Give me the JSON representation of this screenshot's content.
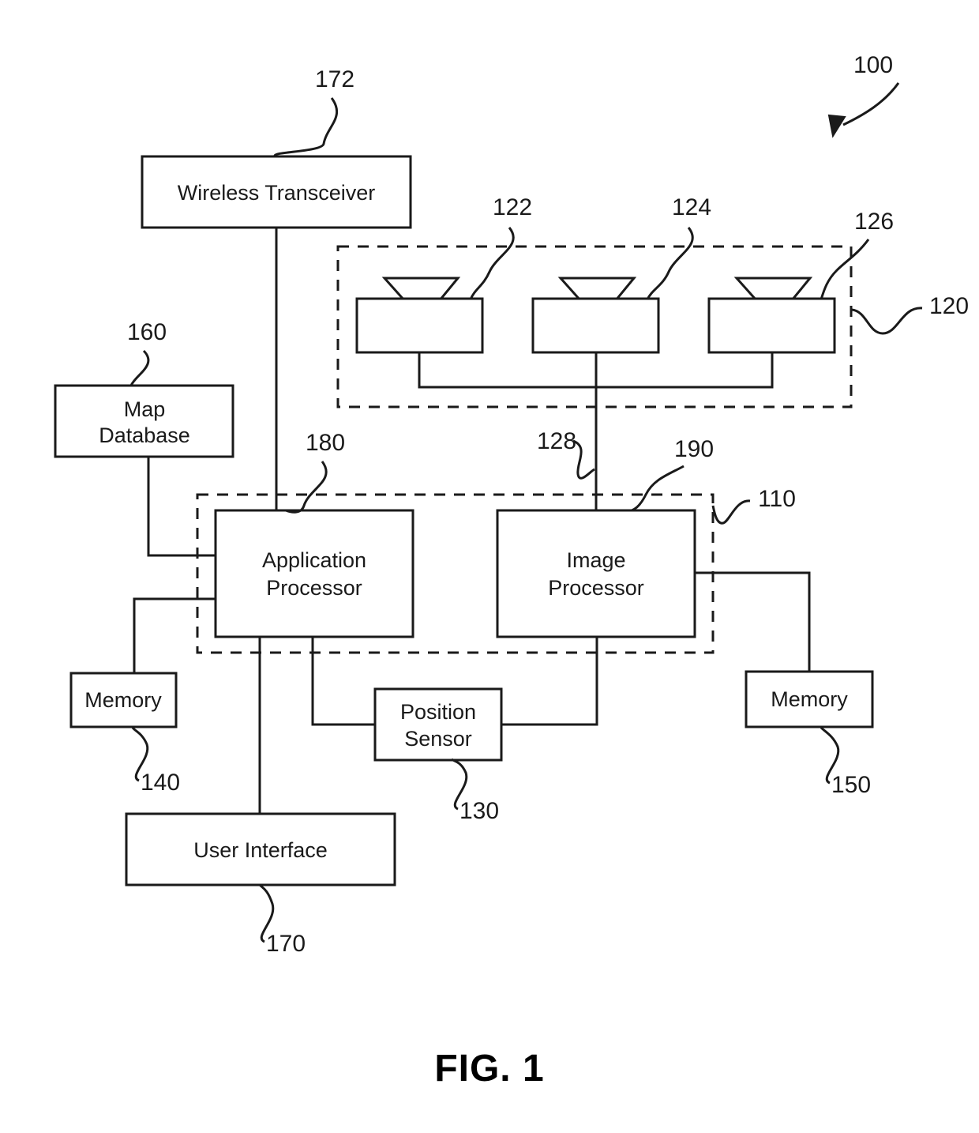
{
  "figure": {
    "caption": "FIG. 1",
    "system_ref": "100"
  },
  "blocks": {
    "wireless_transceiver": {
      "label": "Wireless Transceiver",
      "ref": "172"
    },
    "map_database": {
      "label_line1": "Map",
      "label_line2": "Database",
      "ref": "160"
    },
    "application_processor": {
      "label_line1": "Application",
      "label_line2": "Processor",
      "ref": "180"
    },
    "image_processor": {
      "label_line1": "Image",
      "label_line2": "Processor",
      "ref": "190"
    },
    "memory_left": {
      "label": "Memory",
      "ref": "140"
    },
    "memory_right": {
      "label": "Memory",
      "ref": "150"
    },
    "position_sensor": {
      "label_line1": "Position",
      "label_line2": "Sensor",
      "ref": "130"
    },
    "user_interface": {
      "label": "User Interface",
      "ref": "170"
    }
  },
  "groups": {
    "processing_unit": {
      "ref": "110"
    },
    "image_acquisition_unit": {
      "ref": "120"
    },
    "image_bus": {
      "ref": "128"
    }
  },
  "cameras": [
    {
      "name": "image-capture-device-1",
      "ref": "122"
    },
    {
      "name": "image-capture-device-2",
      "ref": "124"
    },
    {
      "name": "image-capture-device-3",
      "ref": "126"
    }
  ],
  "colors": {
    "line": "#1a1a1a",
    "text": "#1a1a1a",
    "background": "#ffffff"
  }
}
